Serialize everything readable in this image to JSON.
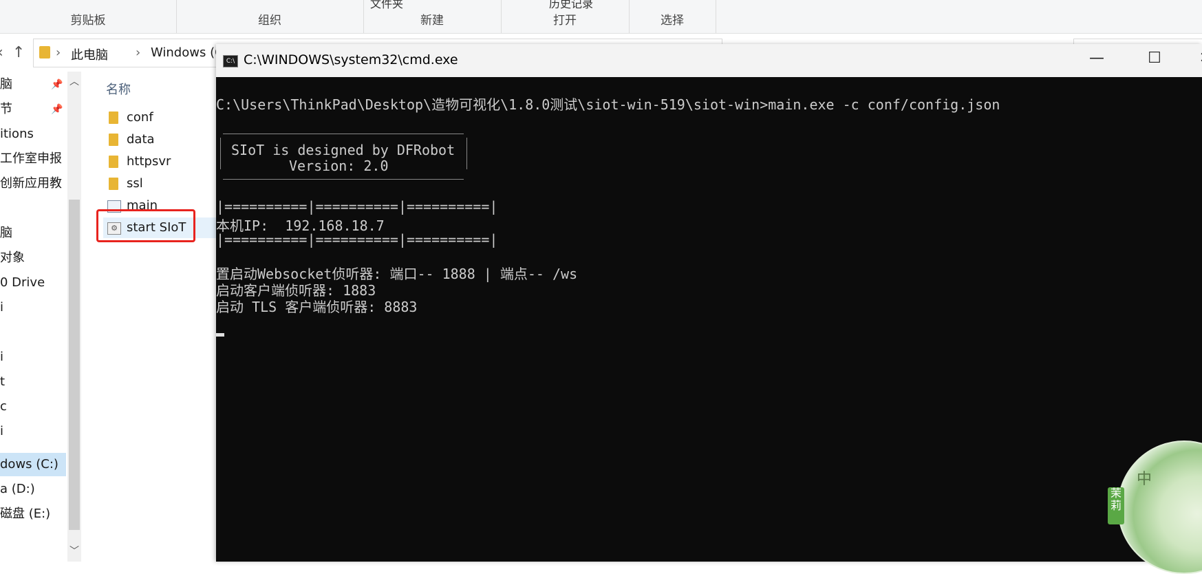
{
  "ribbon": {
    "groups": [
      {
        "label": "剪贴板"
      },
      {
        "label": "组织"
      },
      {
        "label": "新建"
      },
      {
        "label": "打开"
      },
      {
        "label": "选择"
      }
    ],
    "cut_top_labels": [
      "文件夹",
      "历史记录"
    ]
  },
  "address": {
    "segments": [
      "此电脑",
      "Windows (C:)"
    ]
  },
  "nav_pane": {
    "items": [
      {
        "label": "脑",
        "pinned": true
      },
      {
        "label": "节",
        "pinned": true
      },
      {
        "label": "itions"
      },
      {
        "label": "工作室申报"
      },
      {
        "label": "创新应用教"
      },
      {
        "label": ""
      },
      {
        "label": "脑"
      },
      {
        "label": "对象"
      },
      {
        "label": "0 Drive"
      },
      {
        "label": "i"
      },
      {
        "label": ""
      },
      {
        "label": "i"
      },
      {
        "label": "t"
      },
      {
        "label": "c"
      },
      {
        "label": "i"
      },
      {
        "label": "dows (C:)",
        "selected": true
      },
      {
        "label": "a (D:)"
      },
      {
        "label": "磁盘 (E:)"
      }
    ]
  },
  "file_list": {
    "column_header": "名称",
    "items": [
      {
        "name": "conf",
        "type": "folder"
      },
      {
        "name": "data",
        "type": "folder"
      },
      {
        "name": "httpsvr",
        "type": "folder"
      },
      {
        "name": "ssl",
        "type": "folder"
      },
      {
        "name": "main",
        "type": "exe"
      },
      {
        "name": "start SIoT",
        "type": "batch",
        "selected": true
      }
    ]
  },
  "cmd": {
    "title": "C:\\WINDOWS\\system32\\cmd.exe",
    "icon": "C:\\",
    "lines": {
      "command": "C:\\Users\\ThinkPad\\Desktop\\造物可视化\\1.8.0测试\\siot-win-519\\siot-win>main.exe -c conf/config.json",
      "banner1": "SIoT is designed by DFRobot",
      "banner2": "Version: 2.0",
      "sep1": "|==========|==========|==========|",
      "ip": "本机IP:  192.168.18.7",
      "sep2": "|==========|==========|==========|",
      "ws": "置启动Websocket侦听器: 端口-- 1888 | 端点-- /ws",
      "client": "启动客户端侦听器: 1883",
      "tls": "启动 TLS 客户端侦听器: 8883"
    }
  },
  "window_controls": {
    "minimize": "—",
    "maximize": "☐",
    "close": "✕"
  },
  "deco": {
    "tag": "茉莉",
    "char": "中"
  }
}
